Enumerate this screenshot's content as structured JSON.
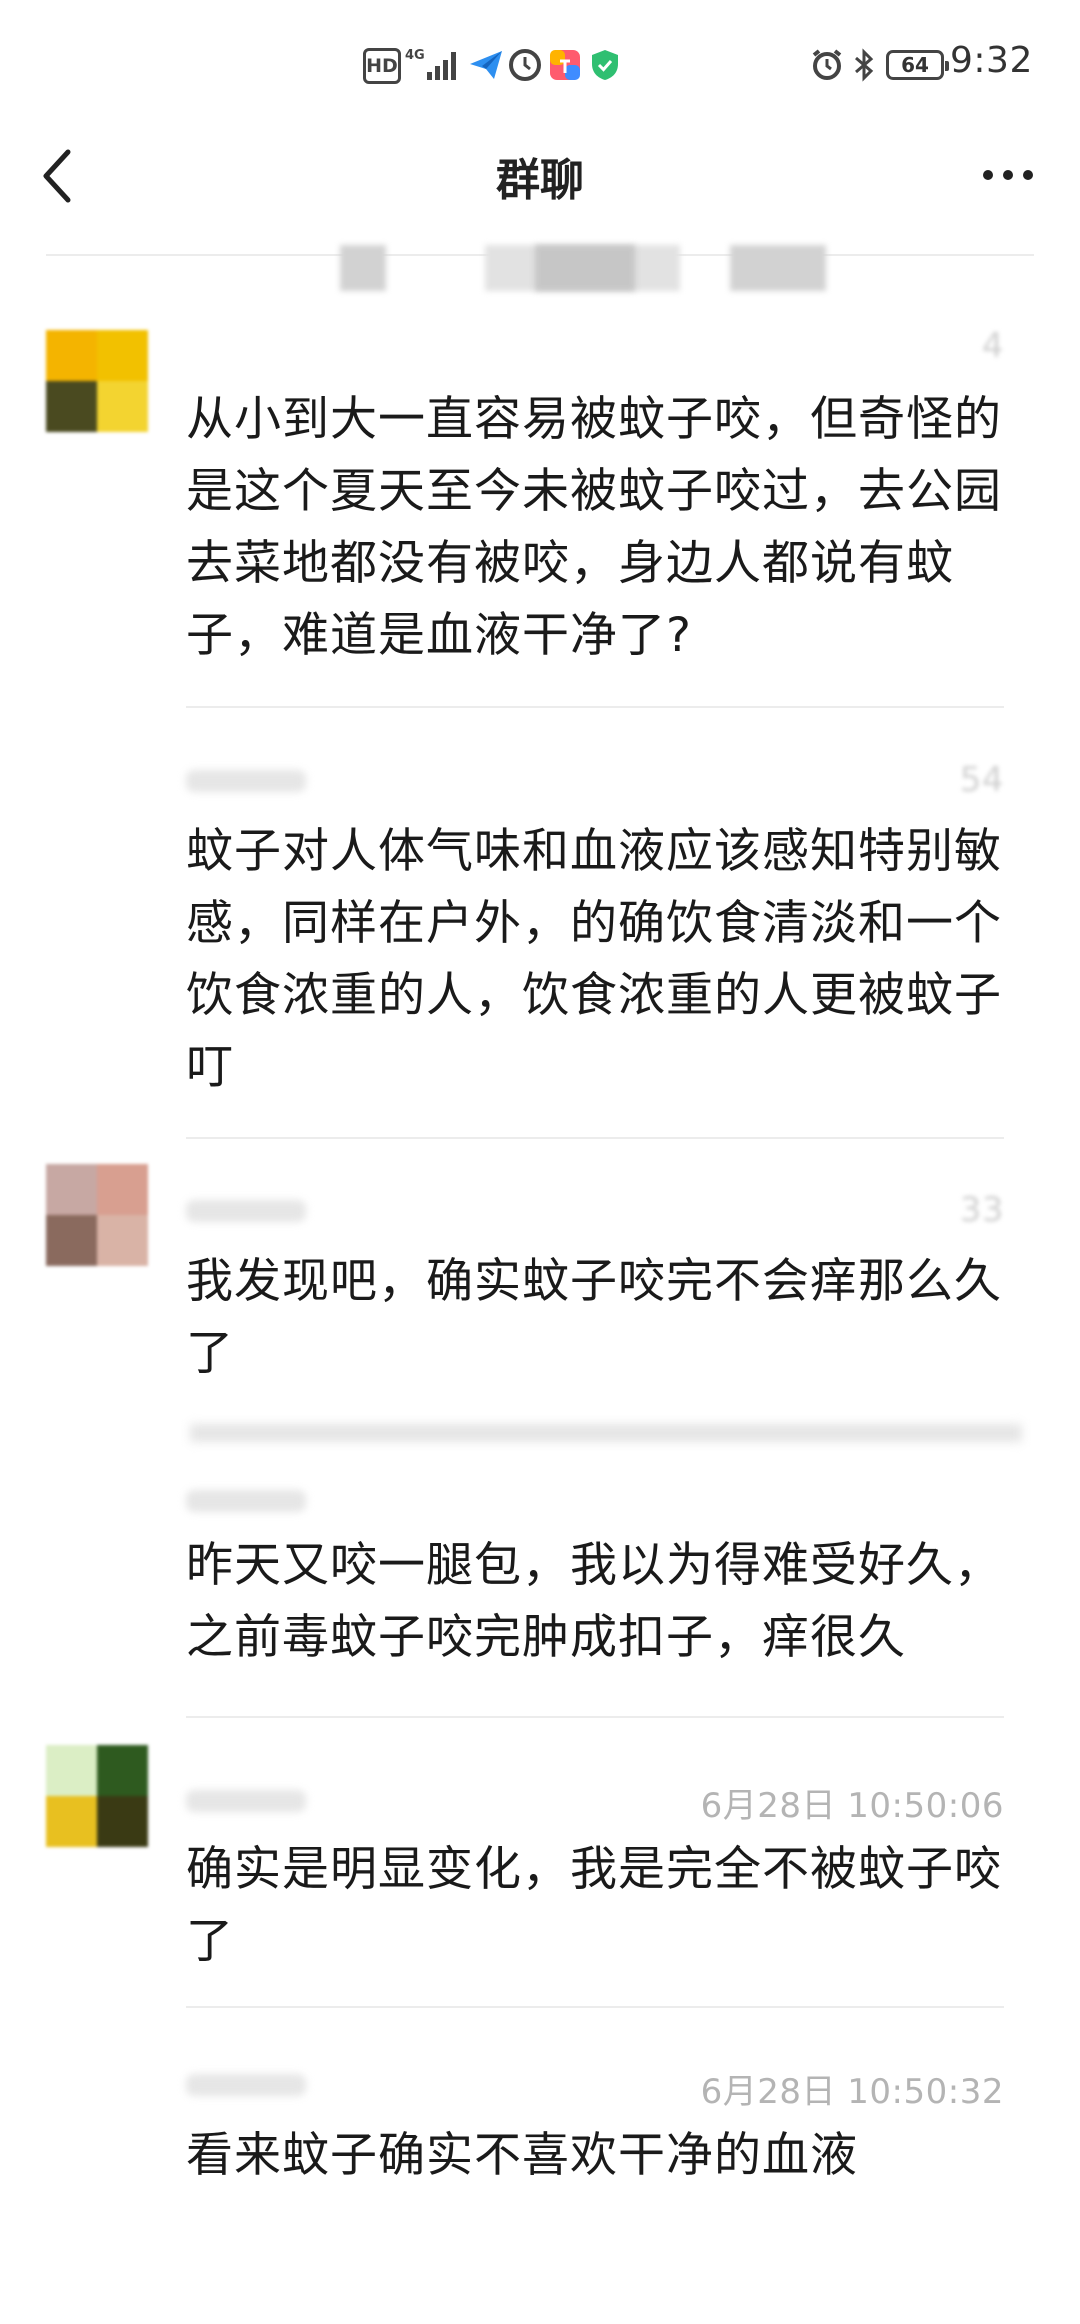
{
  "status_bar": {
    "hd": "HD",
    "network": "4G",
    "battery": "64",
    "time": "9:32"
  },
  "nav": {
    "title": "群聊",
    "back_icon": "chevron-left-icon",
    "more_icon": "more-horizontal-icon"
  },
  "messages": [
    {
      "time": "4",
      "text": "从小到大一直容易被蚊子咬，但奇怪的是这个夏天至今未被蚊子咬过，去公园去菜地都没有被咬，身边人都说有蚊子，难道是血液干净了?"
    },
    {
      "time": "54",
      "text": "蚊子对人体气味和血液应该感知特别敏感，同样在户外，的确饮食清淡和一个饮食浓重的人，饮食浓重的人更被蚊子叮"
    },
    {
      "time": "33",
      "text": "我发现吧，确实蚊子咬完不会痒那么久了"
    },
    {
      "time": "",
      "text": "昨天又咬一腿包，我以为得难受好久，之前毒蚊子咬完肿成扣子，痒很久"
    },
    {
      "time": "6月28日 10:50:06",
      "text": "确实是明显变化，我是完全不被蚊子咬了"
    },
    {
      "time": "6月28日 10:50:32",
      "text": "看来蚊子确实不喜欢干净的血液"
    }
  ],
  "colors": {
    "avatar1": [
      "#f4b400",
      "#f2c100",
      "#4a4a20",
      "#f3d430"
    ],
    "avatar3": [
      "#c7a8a3",
      "#d89f90",
      "#8a6a5e",
      "#d9b3a6"
    ],
    "avatar5": [
      "#dbeec5",
      "#2e5a1f",
      "#e8c020",
      "#3a3a14"
    ]
  }
}
